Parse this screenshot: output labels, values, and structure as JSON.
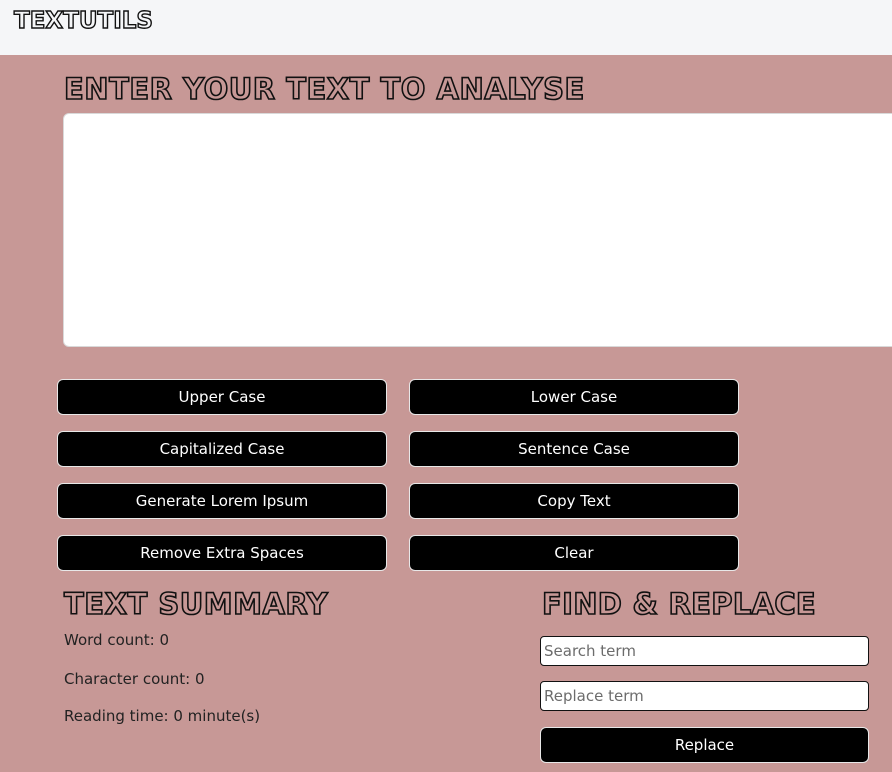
{
  "navbar": {
    "brand": "TEXTUTILS"
  },
  "editor": {
    "heading": "ENTER YOUR TEXT TO ANALYSE",
    "text_value": "",
    "buttons": {
      "upper_case": "Upper Case",
      "lower_case": "Lower Case",
      "capitalized_case": "Capitalized Case",
      "sentence_case": "Sentence Case",
      "generate_lorem": "Generate Lorem Ipsum",
      "copy_text": "Copy Text",
      "remove_extra_spaces": "Remove Extra Spaces",
      "clear": "Clear"
    }
  },
  "summary": {
    "heading": "TEXT SUMMARY",
    "word_count": "Word count: 0",
    "character_count": "Character count: 0",
    "reading_time": "Reading time: 0 minute(s)"
  },
  "find_replace": {
    "heading": "FIND & REPLACE",
    "search_placeholder": "Search term",
    "replace_placeholder": "Replace term",
    "replace_button": "Replace"
  },
  "colors": {
    "background": "#c79896",
    "navbar": "#f5f6f8",
    "button": "#000000"
  }
}
